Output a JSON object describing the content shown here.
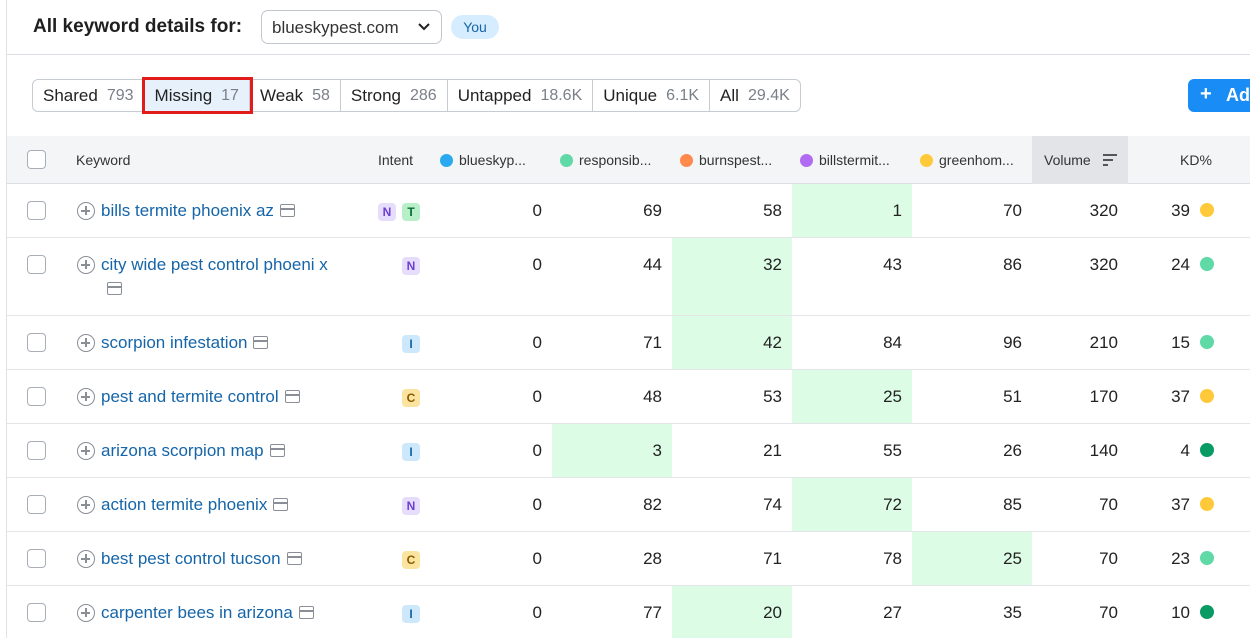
{
  "header": {
    "title": "All keyword details for:",
    "domain": "blueskypest.com",
    "badge": "You"
  },
  "tabs": [
    {
      "label": "Shared",
      "count": "793"
    },
    {
      "label": "Missing",
      "count": "17",
      "active": true
    },
    {
      "label": "Weak",
      "count": "58"
    },
    {
      "label": "Strong",
      "count": "286"
    },
    {
      "label": "Untapped",
      "count": "18.6K"
    },
    {
      "label": "Unique",
      "count": "6.1K"
    },
    {
      "label": "All",
      "count": "29.4K"
    }
  ],
  "add_button": {
    "label": "Add"
  },
  "columns": {
    "keyword": "Keyword",
    "intent": "Intent",
    "competitors": [
      {
        "label": "blueskyp...",
        "color": "#2aa9f0"
      },
      {
        "label": "responsib...",
        "color": "#5fd9a5"
      },
      {
        "label": "burnspest...",
        "color": "#ff8a4c"
      },
      {
        "label": "billstermit...",
        "color": "#b06cf2"
      },
      {
        "label": "greenhom...",
        "color": "#ffc93a"
      }
    ],
    "volume": "Volume",
    "kd": "KD%"
  },
  "kd_colors": {
    "yellow": "#ffc93a",
    "lightgreen": "#5fd9a5",
    "darkgreen": "#0a9a63"
  },
  "rows": [
    {
      "keyword": "bills termite phoenix az",
      "intents": [
        "N",
        "T"
      ],
      "positions": [
        "0",
        "69",
        "58",
        "1",
        "70"
      ],
      "best": 3,
      "volume": "320",
      "kd": "39",
      "kd_color": "yellow",
      "tall": false
    },
    {
      "keyword": "city wide pest control phoeni x",
      "intents": [
        "N"
      ],
      "positions": [
        "0",
        "44",
        "32",
        "43",
        "86"
      ],
      "best": 2,
      "volume": "320",
      "kd": "24",
      "kd_color": "lightgreen",
      "tall": true
    },
    {
      "keyword": "scorpion infestation",
      "intents": [
        "I"
      ],
      "positions": [
        "0",
        "71",
        "42",
        "84",
        "96"
      ],
      "best": 2,
      "volume": "210",
      "kd": "15",
      "kd_color": "lightgreen",
      "tall": false
    },
    {
      "keyword": "pest and termite control",
      "intents": [
        "C"
      ],
      "positions": [
        "0",
        "48",
        "53",
        "25",
        "51"
      ],
      "best": 3,
      "volume": "170",
      "kd": "37",
      "kd_color": "yellow",
      "tall": false
    },
    {
      "keyword": "arizona scorpion map",
      "intents": [
        "I"
      ],
      "positions": [
        "0",
        "3",
        "21",
        "55",
        "26"
      ],
      "best": 1,
      "volume": "140",
      "kd": "4",
      "kd_color": "darkgreen",
      "tall": false
    },
    {
      "keyword": "action termite phoenix",
      "intents": [
        "N"
      ],
      "positions": [
        "0",
        "82",
        "74",
        "72",
        "85"
      ],
      "best": 3,
      "volume": "70",
      "kd": "37",
      "kd_color": "yellow",
      "tall": false
    },
    {
      "keyword": "best pest control tucson",
      "intents": [
        "C"
      ],
      "positions": [
        "0",
        "28",
        "71",
        "78",
        "25"
      ],
      "best": 4,
      "volume": "70",
      "kd": "23",
      "kd_color": "lightgreen",
      "tall": false
    },
    {
      "keyword": "carpenter bees in arizona",
      "intents": [
        "I"
      ],
      "positions": [
        "0",
        "77",
        "20",
        "27",
        "35"
      ],
      "best": 2,
      "volume": "70",
      "kd": "10",
      "kd_color": "darkgreen",
      "tall": false
    }
  ]
}
